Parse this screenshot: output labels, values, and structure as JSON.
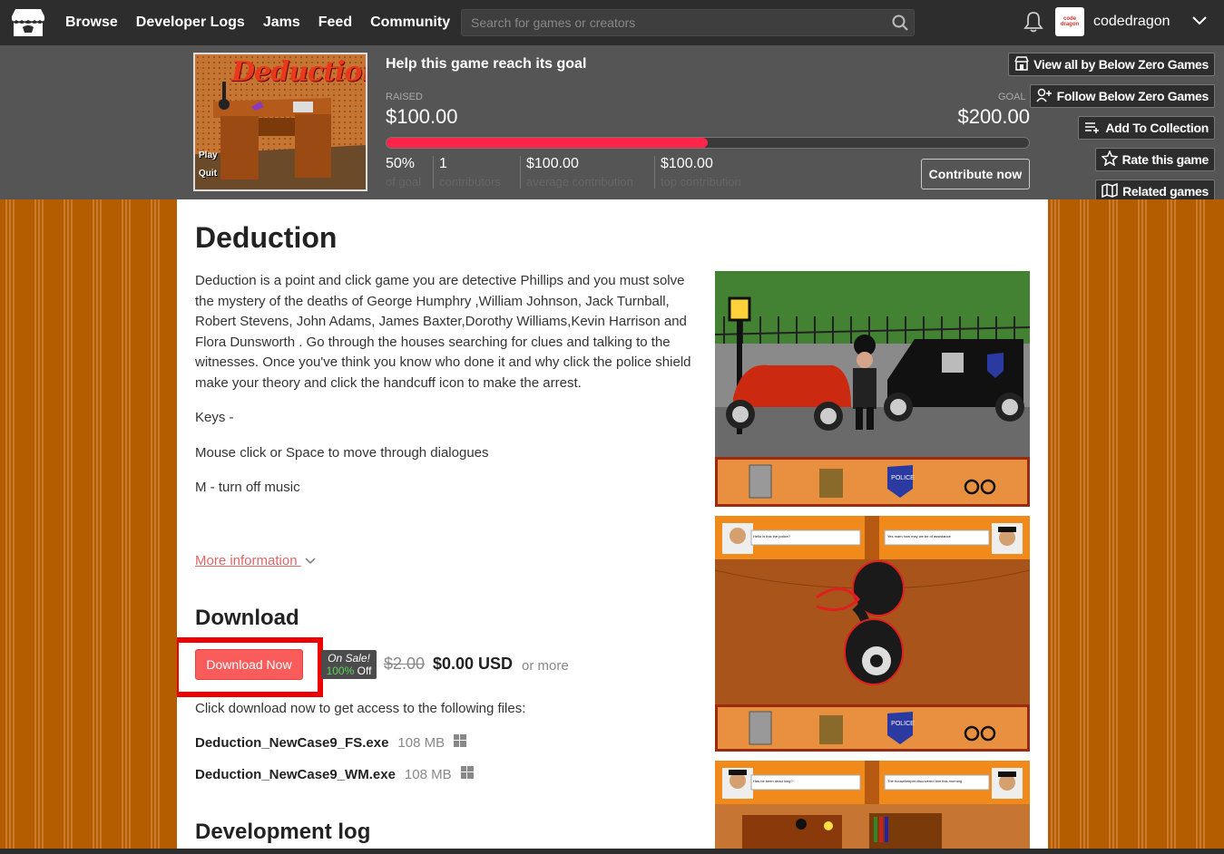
{
  "nav": {
    "links": [
      "Browse",
      "Developer Logs",
      "Jams",
      "Feed",
      "Community"
    ],
    "search_placeholder": "Search for games or creators",
    "username": "codedragon",
    "avatar_text": "code dragon"
  },
  "cover": {
    "title": "Deduction",
    "menu": [
      "Play",
      "Quit"
    ]
  },
  "fundraiser": {
    "title": "Help this game reach its goal",
    "raised_label": "RAISED",
    "raised_value": "$100.00",
    "goal_label": "GOAL",
    "goal_value": "$200.00",
    "progress_fraction": 0.5,
    "stats": [
      {
        "value": "50%",
        "label": "of goal"
      },
      {
        "value": "1",
        "label": "contributors"
      },
      {
        "value": "$100.00",
        "label": "average contribution"
      },
      {
        "value": "$100.00",
        "label": "top contribution"
      }
    ],
    "contribute_label": "Contribute now"
  },
  "side_buttons": [
    {
      "label": "View all by Below Zero Games",
      "icon": "store-icon"
    },
    {
      "label": "Follow Below Zero Games",
      "icon": "follow-icon"
    },
    {
      "label": "Add To Collection",
      "icon": "add-collection-icon"
    },
    {
      "label": "Rate this game",
      "icon": "star-icon"
    },
    {
      "label": "Related games",
      "icon": "map-icon"
    }
  ],
  "game": {
    "title": "Deduction",
    "description": "Deduction is a point and click game you are detective Phillips and you must solve the mystery of the deaths of George Humphry ,William Johnson, Jack Turnball, Robert Stevens,  John  Adams, James Baxter,Dorothy Williams,Kevin Harrison and Flora Dunsworth . Go through the houses searching for clues and talking to the witnesses. Once you've think you know who done it and why click the police shield make your theory and click the handcuff icon to make the arrest.",
    "keys_heading": "Keys -",
    "keys": [
      "Mouse click or Space to move through dialogues",
      "M - turn off music"
    ],
    "more_info": "More information"
  },
  "download": {
    "title": "Download",
    "button_label": "Download Now",
    "sale_line1": "On Sale!",
    "sale_pct": "100%",
    "sale_off": " Off",
    "price_old": "$2.00",
    "price_new": "$0.00 USD",
    "price_more": "or more",
    "info": "Click download now to get access to the following files:",
    "files": [
      {
        "name": "Deduction_NewCase9_FS.exe",
        "size": "108 MB"
      },
      {
        "name": "Deduction_NewCase9_WM.exe",
        "size": "108 MB"
      }
    ]
  },
  "devlog_title": "Development log",
  "screenshots": {
    "police_label": "POLICE",
    "dialog1_left": "Hello is this the police?",
    "dialog1_right": "Yes mam how may we be of assistance",
    "dialog2_left": "Has he been dead long?",
    "dialog2_right": "The housekeeper discovered him this morning"
  }
}
